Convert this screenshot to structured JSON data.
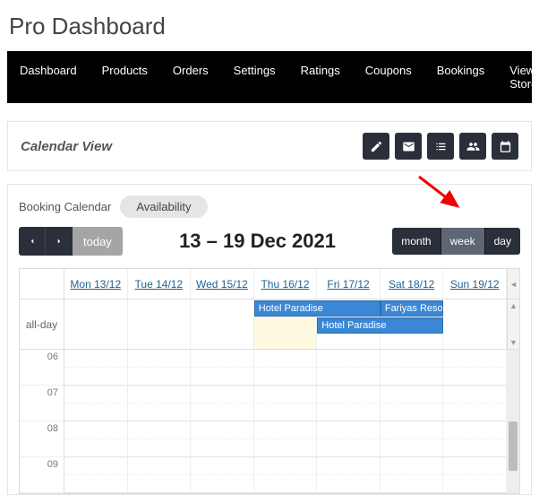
{
  "page_title": "Pro Dashboard",
  "nav": [
    "Dashboard",
    "Products",
    "Orders",
    "Settings",
    "Ratings",
    "Coupons",
    "Bookings",
    "View Store"
  ],
  "panel_title": "Calendar View",
  "icon_buttons": [
    "edit-icon",
    "envelope-icon",
    "list-icon",
    "users-icon",
    "calendar-icon"
  ],
  "tabs": {
    "plain": "Booking Calendar",
    "pill": "Availability"
  },
  "today_label": "today",
  "range_title": "13 – 19 Dec 2021",
  "view_buttons": {
    "month": "month",
    "week": "week",
    "day": "day"
  },
  "day_headers": [
    "Mon 13/12",
    "Tue 14/12",
    "Wed 15/12",
    "Thu 16/12",
    "Fri 17/12",
    "Sat 18/12",
    "Sun 19/12"
  ],
  "all_day_label": "all-day",
  "events": [
    {
      "title": "Hotel Paradise",
      "row": 0,
      "start": 3,
      "span": 2
    },
    {
      "title": "Fariyas Resort",
      "row": 0,
      "start": 5,
      "span": 1
    },
    {
      "title": "Hotel Paradise",
      "row": 1,
      "start": 4,
      "span": 2
    }
  ],
  "time_labels": [
    "06",
    "07",
    "08",
    "09"
  ],
  "highlight_day_index": 3
}
